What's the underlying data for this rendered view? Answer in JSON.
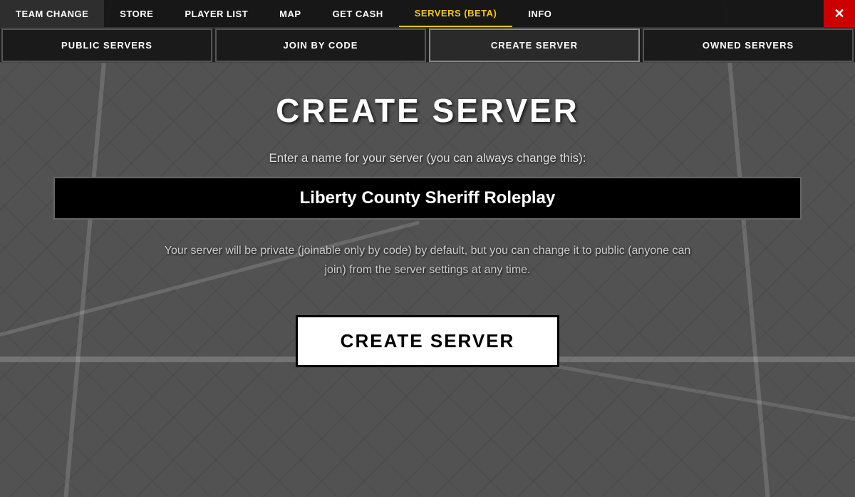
{
  "topnav": {
    "items": [
      {
        "label": "TEAM CHANGE",
        "active": false
      },
      {
        "label": "STORE",
        "active": false
      },
      {
        "label": "PLAYER LIST",
        "active": false
      },
      {
        "label": "MAP",
        "active": false
      },
      {
        "label": "GET CASH",
        "active": false
      },
      {
        "label": "SERVERS (BETA)",
        "active": true
      },
      {
        "label": "INFO",
        "active": false
      }
    ],
    "close_label": "✕"
  },
  "subnav": {
    "tabs": [
      {
        "label": "PUBLIC SERVERS",
        "active": false
      },
      {
        "label": "JOIN BY CODE",
        "active": false
      },
      {
        "label": "CREATE SERVER",
        "active": true
      },
      {
        "label": "OWNED SERVERS",
        "active": false
      }
    ]
  },
  "createserver": {
    "title": "CREATE SERVER",
    "subtitle": "Enter a name for your server (you can always change this):",
    "input_value": "Liberty County Sheriff Roleplay",
    "info_text": "Your server will be private (joinable only by code) by default, but you can change it to public (anyone can join) from the server settings at any time.",
    "button_label": "CREATE SERVER"
  }
}
